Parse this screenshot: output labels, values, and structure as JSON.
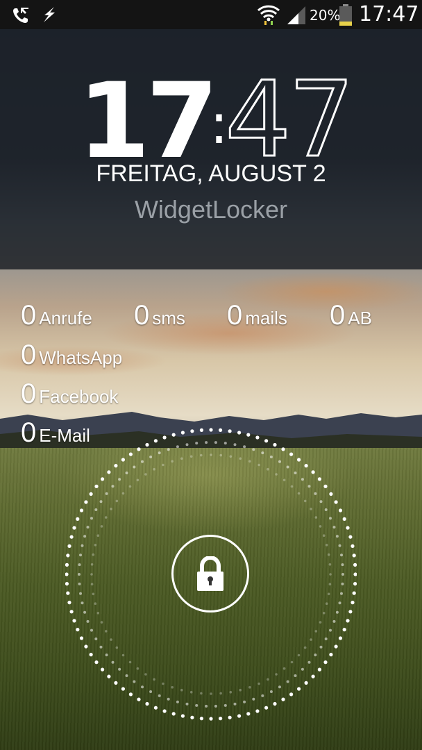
{
  "status_bar": {
    "battery_percent_text": "20%",
    "battery_level": 0.2,
    "time": "17:47",
    "icons": [
      "call-forward-icon",
      "flash-icon",
      "wifi-icon",
      "signal-icon",
      "battery-icon"
    ]
  },
  "lockscreen": {
    "clock_hours": "17",
    "clock_separator": ":",
    "clock_minutes": "47",
    "date": "FREITAG, AUGUST 2",
    "app_name": "WidgetLocker"
  },
  "counters": [
    {
      "count": "0",
      "label": "Anrufe"
    },
    {
      "count": "0",
      "label": "sms"
    },
    {
      "count": "0",
      "label": "mails"
    },
    {
      "count": "0",
      "label": "AB"
    },
    {
      "count": "0",
      "label": "WhatsApp"
    },
    {
      "count": "0",
      "label": "Facebook"
    },
    {
      "count": "0",
      "label": "E-Mail"
    }
  ],
  "unlock": {
    "icon": "padlock-icon"
  },
  "colors": {
    "panel": "#181c22",
    "status_bar": "#141414",
    "battery_fill": "#e8d24a",
    "muted_text": "#9aa0a6"
  }
}
